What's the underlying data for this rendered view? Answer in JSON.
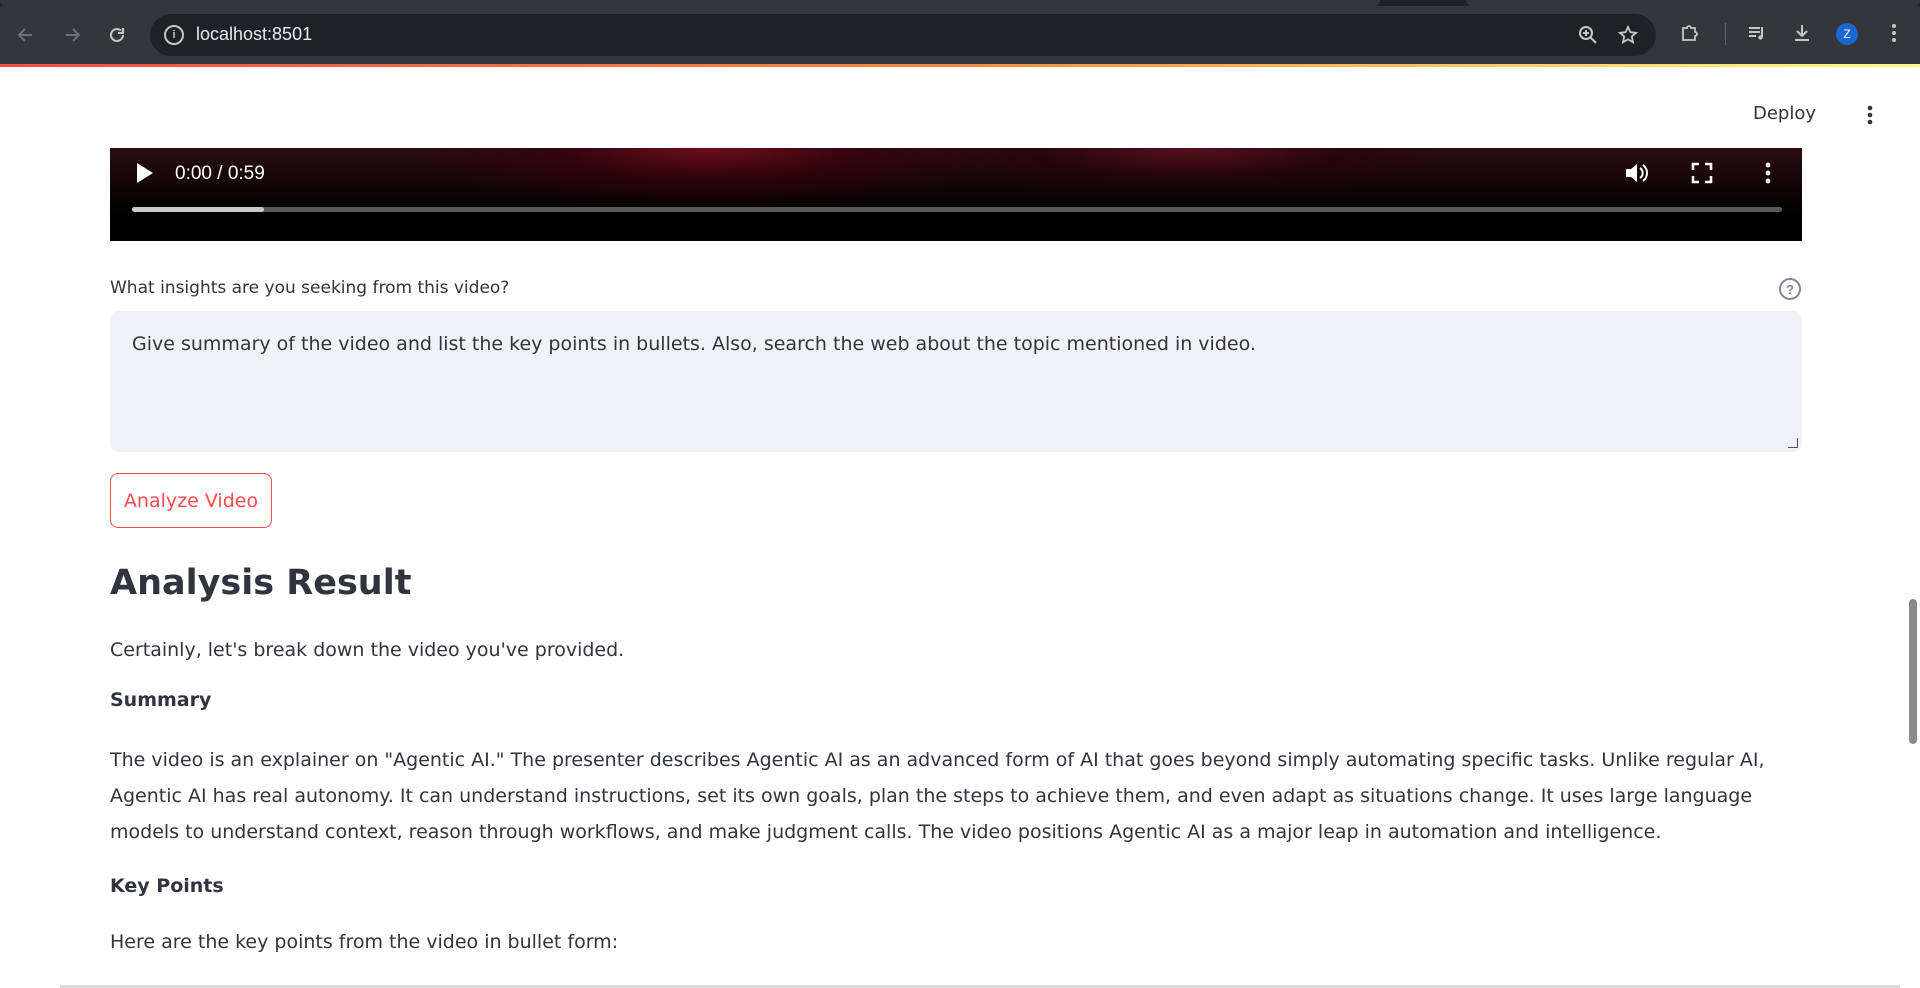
{
  "browser": {
    "url": "localhost:8501",
    "profile_initial": "Z",
    "icons": {
      "back": "arrow-left-icon",
      "forward": "arrow-right-icon",
      "reload": "reload-icon",
      "site_info": "info-icon",
      "zoom": "zoom-icon",
      "bookmark": "star-icon",
      "extensions": "puzzle-icon",
      "media": "media-queue-icon",
      "downloads": "download-icon",
      "menu": "kebab-icon"
    }
  },
  "app": {
    "deploy_label": "Deploy",
    "video": {
      "time_display": "0:00 / 0:59",
      "buffered_fraction": 0.08
    },
    "question_label": "What insights are you seeking from this video?",
    "question_value": "Give summary of the video and list the key points in bullets. Also, search the web about the topic mentioned in video.",
    "analyze_button": "Analyze Video",
    "result": {
      "title": "Analysis Result",
      "intro": "Certainly, let's break down the video you've provided.",
      "summary_heading": "Summary",
      "summary_text": "The video is an explainer on \"Agentic AI.\" The presenter describes Agentic AI as an advanced form of AI that goes beyond simply automating specific tasks. Unlike regular AI, Agentic AI has real autonomy. It can understand instructions, set its own goals, plan the steps to achieve them, and even adapt as situations change. It uses large language models to understand context, reason through workflows, and make judgment calls. The video positions Agentic AI as a major leap in automation and intelligence.",
      "keypoints_heading": "Key Points",
      "keypoints_intro": "Here are the key points from the video in bullet form:"
    }
  },
  "colors": {
    "accent": "#ff4b4b",
    "text": "#31333f",
    "input_bg": "#f0f2f6"
  }
}
